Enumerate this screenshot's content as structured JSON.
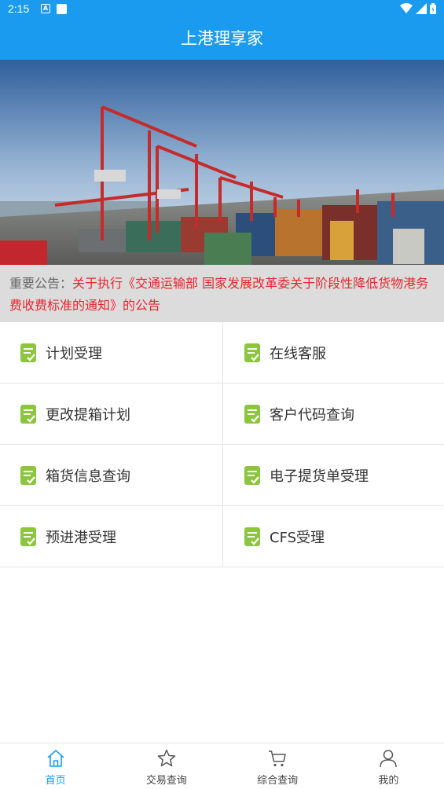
{
  "status_bar": {
    "time": "2:15",
    "a_icon_letter": "A",
    "icons": [
      "a-notification-icon",
      "square-notification-icon",
      "wifi-icon",
      "signal-icon",
      "battery-icon"
    ]
  },
  "app_bar": {
    "title": "上港理享家"
  },
  "hero": {
    "image": "container-port-cranes"
  },
  "notice": {
    "prefix": "重要公告：",
    "message": "关于执行《交通运输部 国家发展改革委关于阶段性降低货物港务费收费标准的通知》的公告"
  },
  "menu": {
    "items": [
      {
        "label": "计划受理",
        "icon": "document-check-icon"
      },
      {
        "label": "在线客服",
        "icon": "document-check-icon"
      },
      {
        "label": "更改提箱计划",
        "icon": "document-check-icon"
      },
      {
        "label": "客户代码查询",
        "icon": "document-check-icon"
      },
      {
        "label": "箱货信息查询",
        "icon": "document-check-icon"
      },
      {
        "label": "电子提货单受理",
        "icon": "document-check-icon"
      },
      {
        "label": "预进港受理",
        "icon": "document-check-icon"
      },
      {
        "label": "CFS受理",
        "icon": "document-check-icon"
      }
    ]
  },
  "tabbar": {
    "tabs": [
      {
        "label": "首页",
        "icon": "home-icon",
        "active": true
      },
      {
        "label": "交易查询",
        "icon": "star-icon",
        "active": false
      },
      {
        "label": "综合查询",
        "icon": "cart-icon",
        "active": false
      },
      {
        "label": "我的",
        "icon": "person-icon",
        "active": false
      }
    ]
  },
  "colors": {
    "primary": "#1a9bef",
    "notice_red": "#e8262e",
    "icon_green": "#8cc63f"
  }
}
